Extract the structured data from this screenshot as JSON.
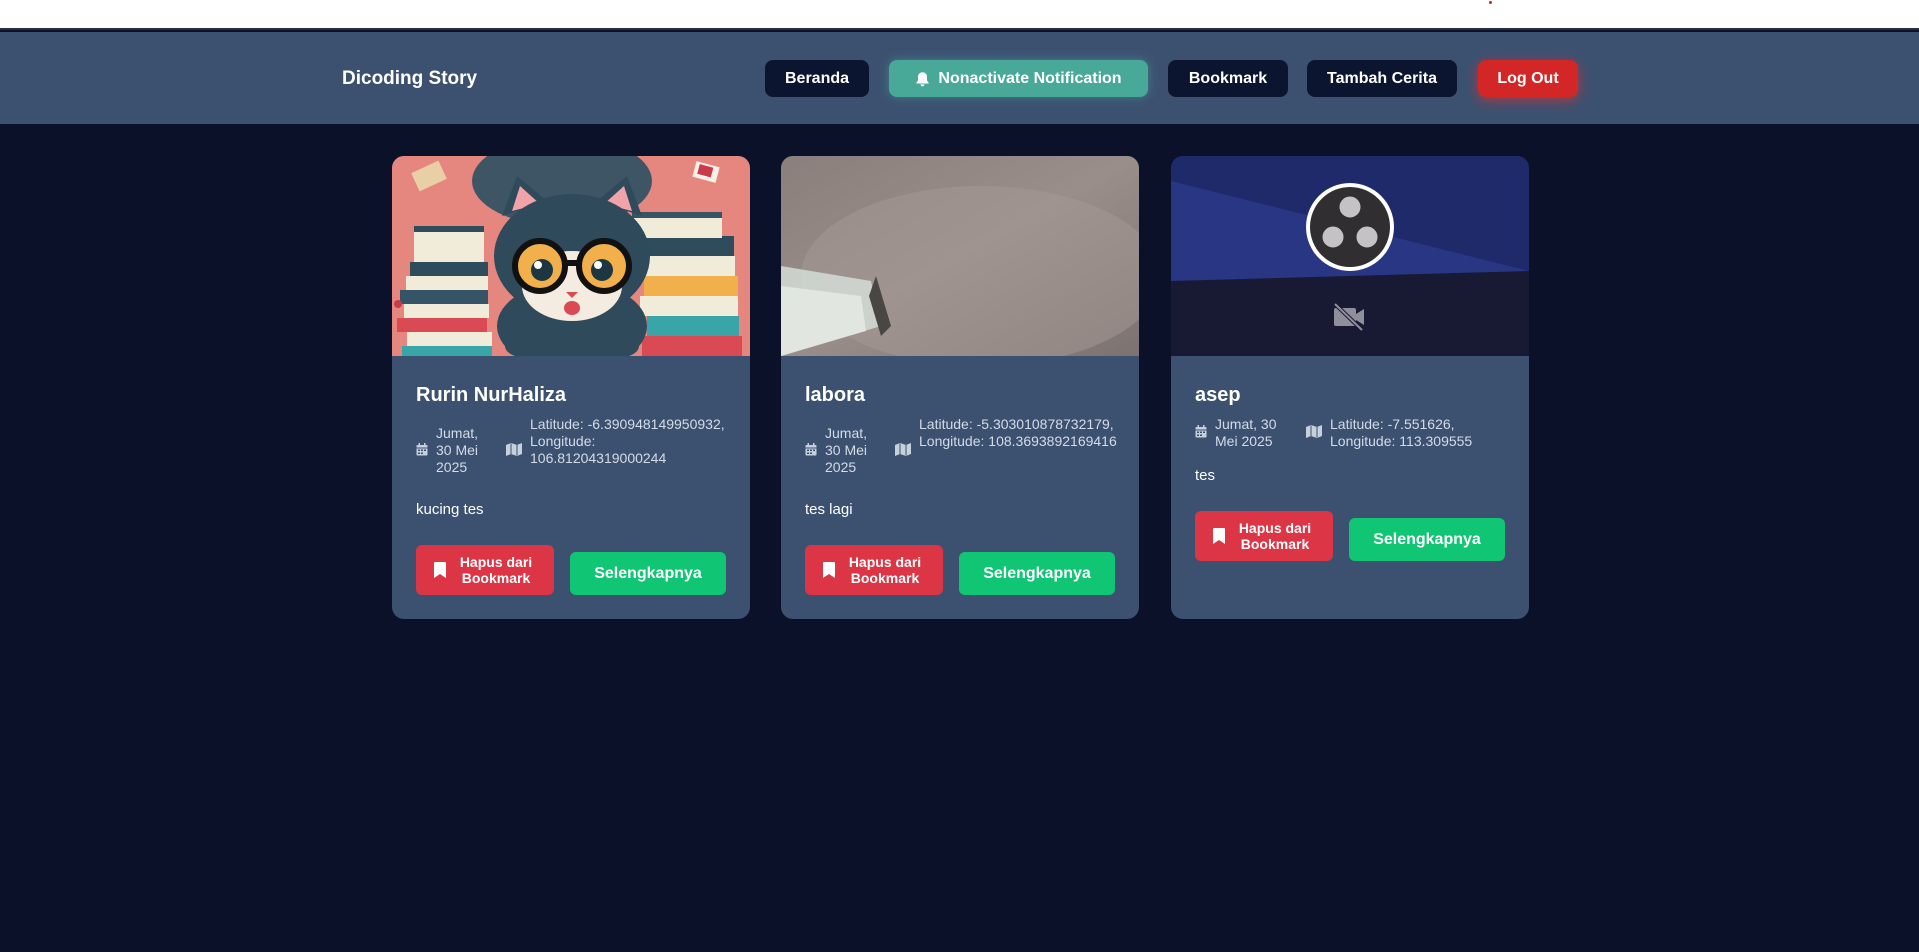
{
  "header": {
    "brand": "Dicoding Story",
    "nav": {
      "home": "Beranda",
      "notification": "Nonactivate Notification",
      "bookmark": "Bookmark",
      "add_story": "Tambah Cerita",
      "logout": "Log Out"
    }
  },
  "colors": {
    "page_bg": "#0a1128",
    "header_bg": "#3c5170",
    "card_bg": "#3c5170",
    "nav_button": "#0b1530",
    "notification_button": "#48a999",
    "logout_button": "#d32727",
    "remove_button": "#dc3545",
    "more_button": "#10c674"
  },
  "icons": {
    "notification": "bell-icon",
    "date": "calendar-icon",
    "location": "map-icon",
    "remove": "bookmark-icon",
    "obs_logo": "obs-logo-icon",
    "camera_off": "video-off-icon"
  },
  "stories": [
    {
      "name": "Rurin NurHaliza",
      "date": "Jumat, 30 Mei 2025",
      "location": "Latitude: -6.390948149950932, Longitude: 106.81204319000244",
      "description": "kucing tes",
      "remove_label": "Hapus dari Bookmark",
      "more_label": "Selengkapnya"
    },
    {
      "name": "labora",
      "date": "Jumat, 30 Mei 2025",
      "location": "Latitude: -5.303010878732179, Longitude: 108.3693892169416",
      "description": "tes lagi",
      "remove_label": "Hapus dari Bookmark",
      "more_label": "Selengkapnya"
    },
    {
      "name": "asep",
      "date": "Jumat, 30 Mei 2025",
      "location": "Latitude: -7.551626, Longitude: 113.309555",
      "description": "tes",
      "remove_label": "Hapus dari Bookmark",
      "more_label": "Selengkapnya"
    }
  ]
}
